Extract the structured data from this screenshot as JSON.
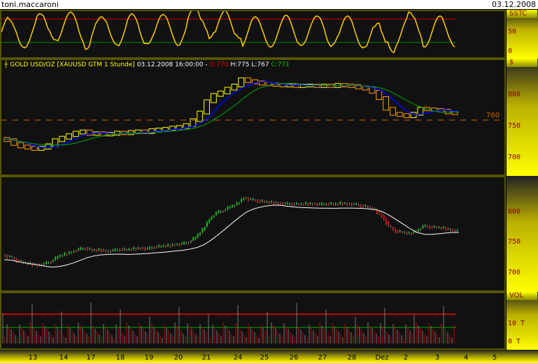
{
  "window": {
    "user": "toni.maccaroni",
    "date": "03.12.2008"
  },
  "legend": {
    "symbol": "GOLD USD/OZ [XAUUSD GTM  1 Stunde]",
    "datetime": "03.12.2008 16:00:00 -",
    "open": "O:770",
    "high": "H:775",
    "low": "L:767",
    "close": "C:771"
  },
  "colors": {
    "background": "#111111",
    "axis": "#ffff00",
    "up": "#00cc00",
    "down": "#dd0000",
    "ma_blue": "#0000ff",
    "ma_green": "#00aa00",
    "level": "#cc6600"
  },
  "chart_data": [
    {
      "type": "line",
      "title": "SSTC",
      "yticks": [
        "50",
        "0"
      ],
      "ylim": [
        -10,
        100
      ]
    },
    {
      "type": "candlestick",
      "ylabel": "$",
      "yticks": [
        "800",
        "750",
        "700"
      ],
      "ylim": [
        670,
        840
      ],
      "hline": {
        "value": 760,
        "label": "760"
      },
      "closes": [
        730,
        728,
        722,
        718,
        716,
        714,
        716,
        720,
        728,
        732,
        736,
        740,
        742,
        738,
        739,
        737,
        738,
        740,
        739,
        741,
        742,
        741,
        744,
        745,
        746,
        748,
        749,
        752,
        760,
        772,
        790,
        800,
        804,
        810,
        815,
        825,
        822,
        820,
        818,
        817,
        816,
        815,
        815,
        814,
        815,
        815,
        814,
        815,
        814,
        816,
        815,
        814,
        812,
        810,
        805,
        795,
        778,
        770,
        768,
        766,
        770,
        778,
        777,
        776,
        775,
        772,
        771
      ]
    },
    {
      "type": "candlestick",
      "yticks": [
        "800",
        "750",
        "700"
      ],
      "ylim": [
        670,
        840
      ]
    },
    {
      "type": "bar",
      "title": "VOL",
      "yticks": [
        "10 T",
        "0 T"
      ]
    }
  ],
  "xaxis": {
    "ticks": [
      "13",
      "14",
      "17",
      "18",
      "19",
      "20",
      "21",
      "24",
      "25",
      "26",
      "27",
      "28",
      "Dez",
      "2",
      "3",
      "4",
      "5"
    ]
  }
}
